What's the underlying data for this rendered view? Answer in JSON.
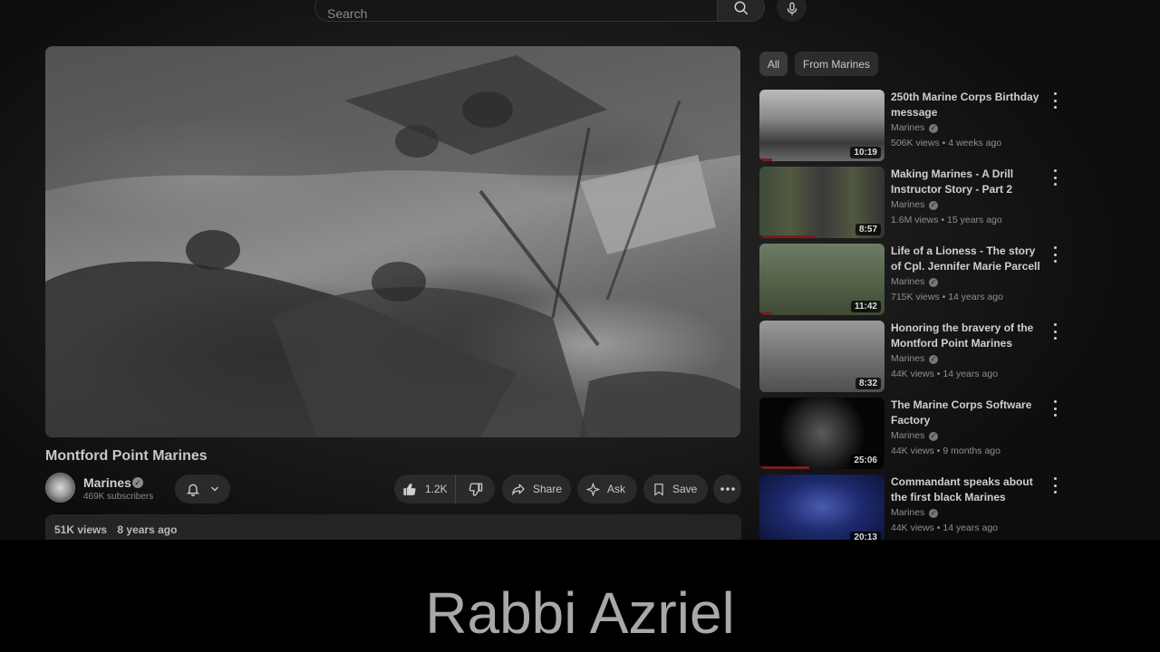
{
  "search": {
    "placeholder": "Search"
  },
  "video": {
    "title": "Montford Point Marines",
    "channel": "Marines",
    "subscribers": "469K subscribers",
    "views": "51K views",
    "age": "8 years ago"
  },
  "actions": {
    "likes": "1.2K",
    "share": "Share",
    "ask": "Ask",
    "save": "Save"
  },
  "filters": [
    "All",
    "From Marines"
  ],
  "recommendations": [
    {
      "title": "250th Marine Corps Birthday message",
      "channel": "Marines",
      "meta": "506K views • 4 weeks ago",
      "duration": "10:19",
      "progress": 0.1
    },
    {
      "title": "Making Marines - A Drill Instructor Story - Part 2",
      "channel": "Marines",
      "meta": "1.6M views • 15 years ago",
      "duration": "8:57",
      "progress": 0.45
    },
    {
      "title": "Life of a Lioness - The story of Cpl. Jennifer Marie Parcell",
      "channel": "Marines",
      "meta": "715K views • 14 years ago",
      "duration": "11:42",
      "progress": 0.1
    },
    {
      "title": "Honoring the bravery of the Montford Point Marines",
      "channel": "Marines",
      "meta": "44K views • 14 years ago",
      "duration": "8:32",
      "progress": 0
    },
    {
      "title": "The Marine Corps Software Factory",
      "channel": "Marines",
      "meta": "44K views • 9 months ago",
      "duration": "25:06",
      "progress": 0.4
    },
    {
      "title": "Commandant speaks about the first black Marines",
      "channel": "Marines",
      "meta": "44K views • 14 years ago",
      "duration": "20:13",
      "progress": 0
    }
  ],
  "caption": "Rabbi Azriel"
}
